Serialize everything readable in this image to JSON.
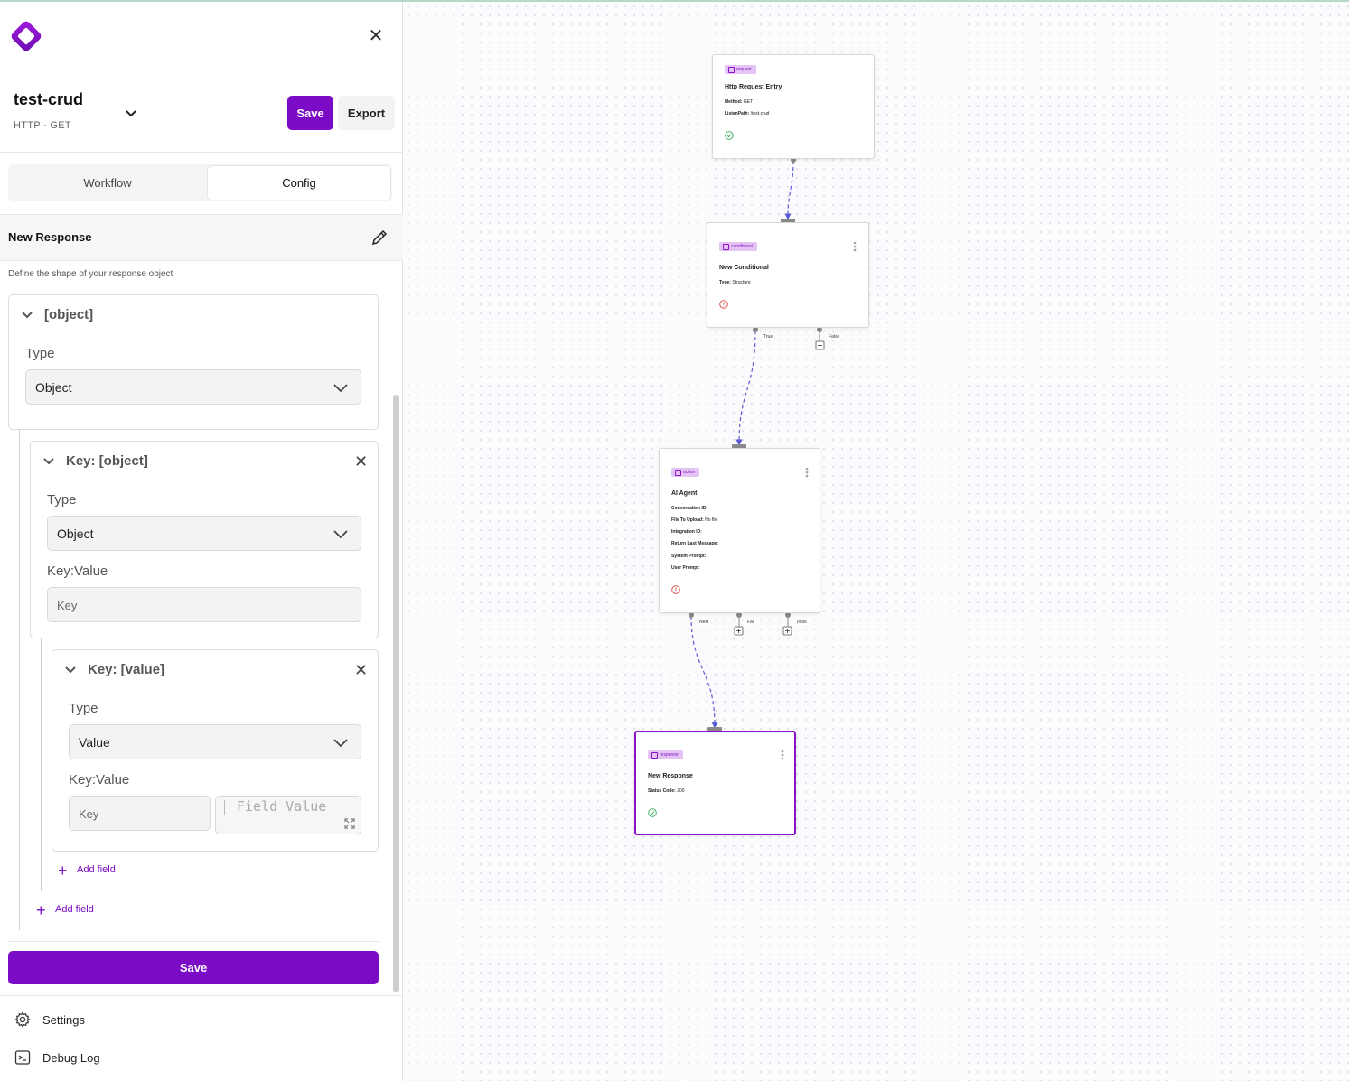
{
  "app": {
    "workflow_name": "test-crud",
    "workflow_subtitle": "HTTP - GET",
    "save_label": "Save",
    "export_label": "Export"
  },
  "tabs": [
    {
      "label": "Workflow",
      "active": false
    },
    {
      "label": "Config",
      "active": true
    }
  ],
  "panel": {
    "title": "New Response",
    "description": "Define the shape of your response object",
    "root_card": {
      "heading": "[object]",
      "type_label": "Type",
      "type_value": "Object"
    },
    "child_card": {
      "heading": "Key: [object]",
      "type_label": "Type",
      "type_value": "Object",
      "kv_label": "Key:Value",
      "key_placeholder": "Key"
    },
    "grandchild_card": {
      "heading": "Key: [value]",
      "type_label": "Type",
      "type_value": "Value",
      "kv_label": "Key:Value",
      "key_placeholder": "Key",
      "value_placeholder": "Field Value"
    },
    "add_field_inner": "Add field",
    "add_field_outer": "Add field",
    "save_label": "Save"
  },
  "footer": {
    "settings_label": "Settings",
    "debug_label": "Debug Log"
  },
  "colors": {
    "accent": "#7b0bc4",
    "edge": "#5b5bd6",
    "ok": "#2eaa4f",
    "error": "#d9433a"
  },
  "canvas": {
    "nodes": {
      "http": {
        "badge": "request",
        "title": "Http Request Entry",
        "props": [
          {
            "k": "Method:",
            "v": "GET"
          },
          {
            "k": "ListenPath:",
            "v": "/test-crud"
          }
        ],
        "status": "ok"
      },
      "conditional": {
        "badge": "conditional",
        "title": "New Conditional",
        "props": [
          {
            "k": "Type:",
            "v": "Structure"
          }
        ],
        "status": "error",
        "ports": [
          "True",
          "False"
        ]
      },
      "agent": {
        "badge": "action",
        "title": "AI Agent",
        "props": [
          {
            "k": "Conversation ID:",
            "v": ""
          },
          {
            "k": "File To Upload:",
            "v": "No file"
          },
          {
            "k": "Integration ID:",
            "v": ""
          },
          {
            "k": "Return Last Message:",
            "v": ""
          },
          {
            "k": "System Prompt:",
            "v": ""
          },
          {
            "k": "User Prompt:",
            "v": ""
          }
        ],
        "status": "error",
        "ports": [
          "Next",
          "Fail",
          "Tools"
        ]
      },
      "response": {
        "badge": "response",
        "title": "New Response",
        "props": [
          {
            "k": "Status Code:",
            "v": "200"
          }
        ],
        "status": "ok"
      }
    }
  }
}
